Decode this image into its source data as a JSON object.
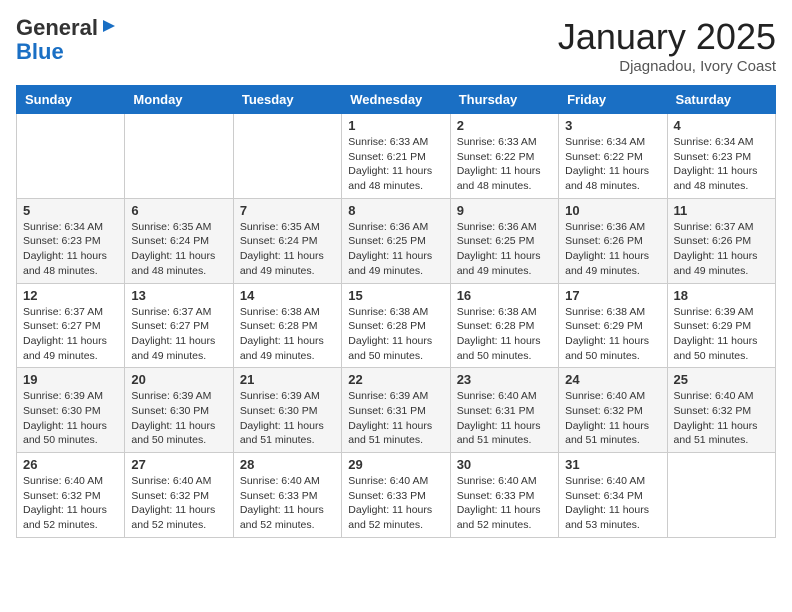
{
  "logo": {
    "general": "General",
    "blue": "Blue"
  },
  "header": {
    "month": "January 2025",
    "location": "Djagnadou, Ivory Coast"
  },
  "weekdays": [
    "Sunday",
    "Monday",
    "Tuesday",
    "Wednesday",
    "Thursday",
    "Friday",
    "Saturday"
  ],
  "weeks": [
    [
      {
        "day": "",
        "info": ""
      },
      {
        "day": "",
        "info": ""
      },
      {
        "day": "",
        "info": ""
      },
      {
        "day": "1",
        "info": "Sunrise: 6:33 AM\nSunset: 6:21 PM\nDaylight: 11 hours\nand 48 minutes."
      },
      {
        "day": "2",
        "info": "Sunrise: 6:33 AM\nSunset: 6:22 PM\nDaylight: 11 hours\nand 48 minutes."
      },
      {
        "day": "3",
        "info": "Sunrise: 6:34 AM\nSunset: 6:22 PM\nDaylight: 11 hours\nand 48 minutes."
      },
      {
        "day": "4",
        "info": "Sunrise: 6:34 AM\nSunset: 6:23 PM\nDaylight: 11 hours\nand 48 minutes."
      }
    ],
    [
      {
        "day": "5",
        "info": "Sunrise: 6:34 AM\nSunset: 6:23 PM\nDaylight: 11 hours\nand 48 minutes."
      },
      {
        "day": "6",
        "info": "Sunrise: 6:35 AM\nSunset: 6:24 PM\nDaylight: 11 hours\nand 48 minutes."
      },
      {
        "day": "7",
        "info": "Sunrise: 6:35 AM\nSunset: 6:24 PM\nDaylight: 11 hours\nand 49 minutes."
      },
      {
        "day": "8",
        "info": "Sunrise: 6:36 AM\nSunset: 6:25 PM\nDaylight: 11 hours\nand 49 minutes."
      },
      {
        "day": "9",
        "info": "Sunrise: 6:36 AM\nSunset: 6:25 PM\nDaylight: 11 hours\nand 49 minutes."
      },
      {
        "day": "10",
        "info": "Sunrise: 6:36 AM\nSunset: 6:26 PM\nDaylight: 11 hours\nand 49 minutes."
      },
      {
        "day": "11",
        "info": "Sunrise: 6:37 AM\nSunset: 6:26 PM\nDaylight: 11 hours\nand 49 minutes."
      }
    ],
    [
      {
        "day": "12",
        "info": "Sunrise: 6:37 AM\nSunset: 6:27 PM\nDaylight: 11 hours\nand 49 minutes."
      },
      {
        "day": "13",
        "info": "Sunrise: 6:37 AM\nSunset: 6:27 PM\nDaylight: 11 hours\nand 49 minutes."
      },
      {
        "day": "14",
        "info": "Sunrise: 6:38 AM\nSunset: 6:28 PM\nDaylight: 11 hours\nand 49 minutes."
      },
      {
        "day": "15",
        "info": "Sunrise: 6:38 AM\nSunset: 6:28 PM\nDaylight: 11 hours\nand 50 minutes."
      },
      {
        "day": "16",
        "info": "Sunrise: 6:38 AM\nSunset: 6:28 PM\nDaylight: 11 hours\nand 50 minutes."
      },
      {
        "day": "17",
        "info": "Sunrise: 6:38 AM\nSunset: 6:29 PM\nDaylight: 11 hours\nand 50 minutes."
      },
      {
        "day": "18",
        "info": "Sunrise: 6:39 AM\nSunset: 6:29 PM\nDaylight: 11 hours\nand 50 minutes."
      }
    ],
    [
      {
        "day": "19",
        "info": "Sunrise: 6:39 AM\nSunset: 6:30 PM\nDaylight: 11 hours\nand 50 minutes."
      },
      {
        "day": "20",
        "info": "Sunrise: 6:39 AM\nSunset: 6:30 PM\nDaylight: 11 hours\nand 50 minutes."
      },
      {
        "day": "21",
        "info": "Sunrise: 6:39 AM\nSunset: 6:30 PM\nDaylight: 11 hours\nand 51 minutes."
      },
      {
        "day": "22",
        "info": "Sunrise: 6:39 AM\nSunset: 6:31 PM\nDaylight: 11 hours\nand 51 minutes."
      },
      {
        "day": "23",
        "info": "Sunrise: 6:40 AM\nSunset: 6:31 PM\nDaylight: 11 hours\nand 51 minutes."
      },
      {
        "day": "24",
        "info": "Sunrise: 6:40 AM\nSunset: 6:32 PM\nDaylight: 11 hours\nand 51 minutes."
      },
      {
        "day": "25",
        "info": "Sunrise: 6:40 AM\nSunset: 6:32 PM\nDaylight: 11 hours\nand 51 minutes."
      }
    ],
    [
      {
        "day": "26",
        "info": "Sunrise: 6:40 AM\nSunset: 6:32 PM\nDaylight: 11 hours\nand 52 minutes."
      },
      {
        "day": "27",
        "info": "Sunrise: 6:40 AM\nSunset: 6:32 PM\nDaylight: 11 hours\nand 52 minutes."
      },
      {
        "day": "28",
        "info": "Sunrise: 6:40 AM\nSunset: 6:33 PM\nDaylight: 11 hours\nand 52 minutes."
      },
      {
        "day": "29",
        "info": "Sunrise: 6:40 AM\nSunset: 6:33 PM\nDaylight: 11 hours\nand 52 minutes."
      },
      {
        "day": "30",
        "info": "Sunrise: 6:40 AM\nSunset: 6:33 PM\nDaylight: 11 hours\nand 52 minutes."
      },
      {
        "day": "31",
        "info": "Sunrise: 6:40 AM\nSunset: 6:34 PM\nDaylight: 11 hours\nand 53 minutes."
      },
      {
        "day": "",
        "info": ""
      }
    ]
  ]
}
